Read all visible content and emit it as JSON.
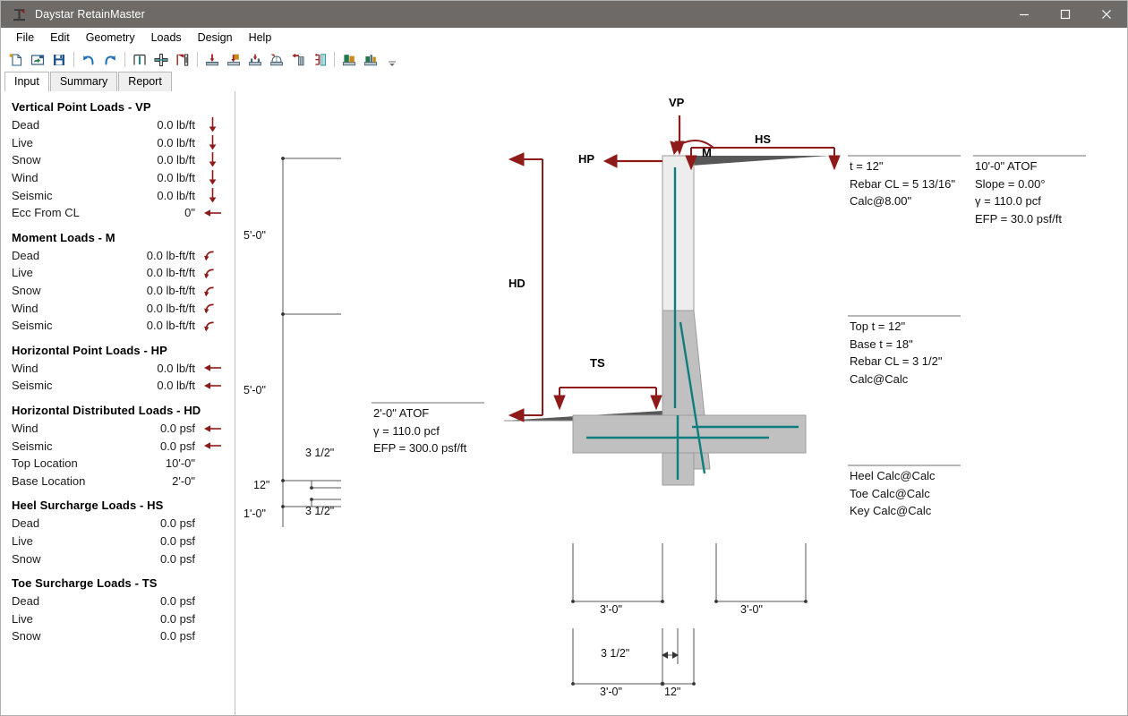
{
  "window": {
    "title": "Daystar RetainMaster",
    "icon": "column-base-icon",
    "minimize_label": "—",
    "maximize_label": "□",
    "close_label": "×"
  },
  "menubar": {
    "items": [
      {
        "label": "File"
      },
      {
        "label": "Edit"
      },
      {
        "label": "Geometry"
      },
      {
        "label": "Loads"
      },
      {
        "label": "Design"
      },
      {
        "label": "Help"
      }
    ]
  },
  "toolbar": {
    "buttons": [
      {
        "name": "new-file-icon"
      },
      {
        "name": "open-file-icon"
      },
      {
        "name": "save-file-icon"
      },
      {
        "name": "undo-icon"
      },
      {
        "name": "redo-icon"
      },
      {
        "name": "stem-geometry-icon"
      },
      {
        "name": "footing-geometry-icon"
      },
      {
        "name": "soil-profile-icon"
      },
      {
        "name": "vertical-load-icon"
      },
      {
        "name": "moment-load-icon"
      },
      {
        "name": "heel-surcharge-icon"
      },
      {
        "name": "toe-surcharge-icon"
      },
      {
        "name": "horizontal-point-load-icon"
      },
      {
        "name": "horizontal-distributed-load-icon"
      },
      {
        "name": "design-stem-icon"
      },
      {
        "name": "design-footing-icon"
      }
    ],
    "overflow_label": "⌄"
  },
  "tabs": [
    {
      "label": "Input",
      "active": true
    },
    {
      "label": "Summary",
      "active": false
    },
    {
      "label": "Report",
      "active": false
    }
  ],
  "sidebar": {
    "sections": [
      {
        "title": "Vertical Point Loads - VP",
        "rows": [
          {
            "label": "Dead",
            "value": "0.0 lb/ft",
            "arrow": "down-arrow-icon"
          },
          {
            "label": "Live",
            "value": "0.0 lb/ft",
            "arrow": "down-arrow-icon"
          },
          {
            "label": "Snow",
            "value": "0.0 lb/ft",
            "arrow": "down-arrow-icon"
          },
          {
            "label": "Wind",
            "value": "0.0 lb/ft",
            "arrow": "down-arrow-icon"
          },
          {
            "label": "Seismic",
            "value": "0.0 lb/ft",
            "arrow": "down-arrow-icon"
          },
          {
            "label": "Ecc From CL",
            "value": "0\"",
            "arrow": "left-arrow-icon"
          }
        ]
      },
      {
        "title": "Moment Loads - M",
        "rows": [
          {
            "label": "Dead",
            "value": "0.0 lb-ft/ft",
            "arrow": "moment-arrow-icon"
          },
          {
            "label": "Live",
            "value": "0.0 lb-ft/ft",
            "arrow": "moment-arrow-icon"
          },
          {
            "label": "Snow",
            "value": "0.0 lb-ft/ft",
            "arrow": "moment-arrow-icon"
          },
          {
            "label": "Wind",
            "value": "0.0 lb-ft/ft",
            "arrow": "moment-arrow-icon"
          },
          {
            "label": "Seismic",
            "value": "0.0 lb-ft/ft",
            "arrow": "moment-arrow-icon"
          }
        ]
      },
      {
        "title": "Horizontal Point Loads - HP",
        "rows": [
          {
            "label": "Wind",
            "value": "0.0 lb/ft",
            "arrow": "left-arrow-icon"
          },
          {
            "label": "Seismic",
            "value": "0.0 lb/ft",
            "arrow": "left-arrow-icon"
          }
        ]
      },
      {
        "title": "Horizontal Distributed Loads - HD",
        "rows": [
          {
            "label": "Wind",
            "value": "0.0 psf",
            "arrow": "left-arrow-icon"
          },
          {
            "label": "Seismic",
            "value": "0.0 psf",
            "arrow": "left-arrow-icon"
          },
          {
            "label": "Top Location",
            "value": "10'-0\"",
            "arrow": ""
          },
          {
            "label": "Base Location",
            "value": "2'-0\"",
            "arrow": ""
          }
        ]
      },
      {
        "title": "Heel Surcharge Loads - HS",
        "rows": [
          {
            "label": "Dead",
            "value": "0.0 psf",
            "arrow": ""
          },
          {
            "label": "Live",
            "value": "0.0 psf",
            "arrow": ""
          },
          {
            "label": "Snow",
            "value": "0.0 psf",
            "arrow": ""
          }
        ]
      },
      {
        "title": "Toe Surcharge Loads - TS",
        "rows": [
          {
            "label": "Dead",
            "value": "0.0 psf",
            "arrow": ""
          },
          {
            "label": "Live",
            "value": "0.0 psf",
            "arrow": ""
          },
          {
            "label": "Snow",
            "value": "0.0 psf",
            "arrow": ""
          }
        ]
      }
    ]
  },
  "drawing": {
    "load_labels": {
      "vp": "VP",
      "m": "M",
      "hs": "HS",
      "hp": "HP",
      "hd": "HD",
      "ts": "TS"
    },
    "dimensions": {
      "left_upper": "5'-0\"",
      "left_lower": "5'-0\"",
      "footing_thickness": "12\"",
      "key_depth": "1'-0\"",
      "rebar_cover_top": "3 1/2\"",
      "rebar_cover_bottom": "3 1/2\"",
      "heel_width": "3'-0\"",
      "toe_width": "3'-0\"",
      "key_offset": "3'-0\"",
      "key_width": "12\"",
      "key_rebar_cover": "3 1/2\""
    },
    "notes": {
      "stem_top": [
        "t = 12\"",
        "Rebar CL = 5 13/16\"",
        "Calc@8.00\""
      ],
      "soil_top": [
        "10'-0\" ATOF",
        "Slope = 0.00°",
        "γ = 110.0 pcf",
        "EFP = 30.0 psf/ft"
      ],
      "stem_base": [
        "Top t = 12\"",
        "Base t = 18\"",
        "Rebar CL = 3 1/2\"",
        "Calc@Calc"
      ],
      "footing": [
        "Heel Calc@Calc",
        "Toe Calc@Calc",
        "Key Calc@Calc"
      ],
      "soil_front": [
        "2'-0\" ATOF",
        "γ = 110.0 pcf",
        "EFP = 300.0 psf/ft"
      ]
    }
  },
  "colors": {
    "titlebar": "#6d6a67",
    "load_arrow": "#8f1a1a",
    "rebar": "#0e7d7d",
    "concrete_light": "#ededed",
    "concrete_mid": "#c0c0c0",
    "soil_dark": "#585858",
    "dimension_line": "#6f6f6f",
    "panel_border": "#bfbfbf"
  }
}
